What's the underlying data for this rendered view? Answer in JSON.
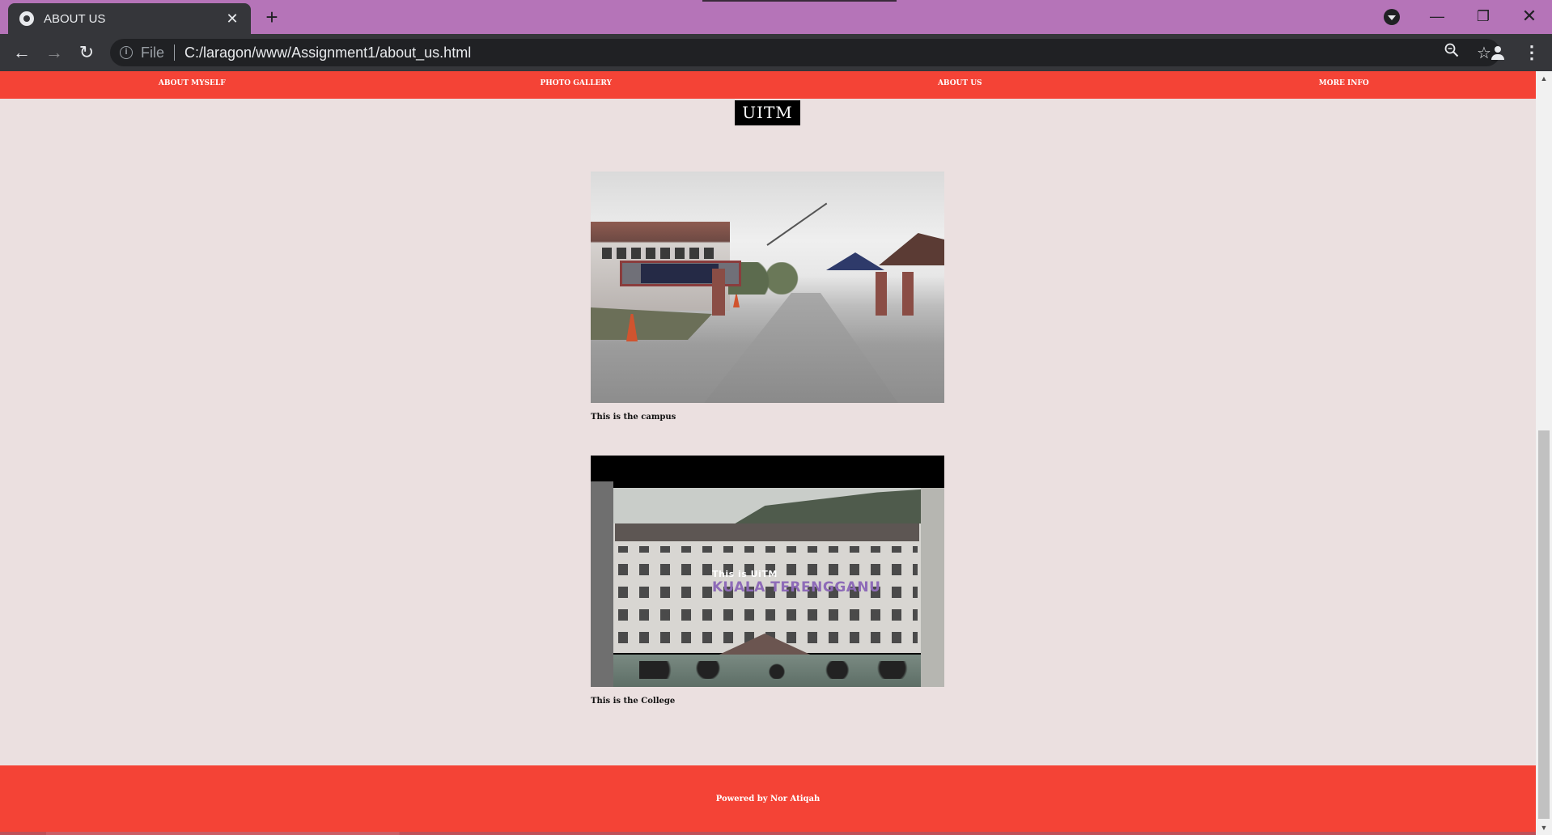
{
  "browser": {
    "tab_title": "ABOUT US",
    "tab_close": "✕",
    "new_tab": "+",
    "scheme": "File",
    "url": "C:/laragon/www/Assignment1/about_us.html",
    "controls": {
      "minimize": "—",
      "maximize": "❐",
      "close": "✕"
    },
    "nav": {
      "back": "←",
      "forward": "→",
      "reload": "↻"
    },
    "icons": {
      "zoom": "zoom-icon",
      "bookmark": "star-icon",
      "profile": "profile-icon",
      "menu": "kebab-menu-icon"
    }
  },
  "site": {
    "nav": [
      "ABOUT MYSELF",
      "PHOTO GALLERY",
      "ABOUT US",
      "MORE INFO"
    ],
    "brand": "UITM",
    "figures": [
      {
        "caption": "This is the campus"
      },
      {
        "caption": "This is the College",
        "overlay_line1": "This is UiTM",
        "overlay_line2": "KUALA TERENGGANU"
      }
    ],
    "footer": "Powered by Nor Atiqah"
  },
  "colors": {
    "titlebar": "#b574b8",
    "toolbar": "#35363a",
    "accent": "#f44336",
    "page_bg": "#ebe0e0"
  }
}
